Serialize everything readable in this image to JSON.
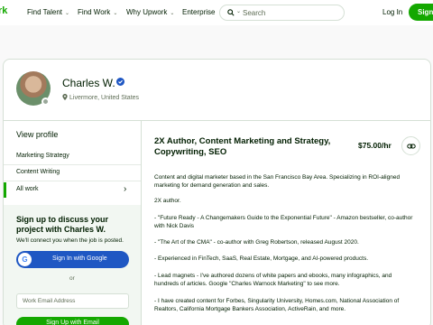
{
  "nav": {
    "logo": "rk",
    "find_talent": "Find Talent",
    "find_work": "Find Work",
    "why_upwork": "Why Upwork",
    "enterprise": "Enterprise",
    "search_placeholder": "Search",
    "login": "Log In",
    "signup": "Sign"
  },
  "profile": {
    "name": "Charles W.",
    "location": "Livermore, United States",
    "headline": "2X Author, Content Marketing and Strategy, Copywriting, SEO",
    "rate": "$75.00/hr",
    "overview": [
      "Content and digital marketer based in the San Francisco Bay Area. Specializing in ROI-aligned marketing for demand generation and sales.",
      "2X author.",
      "- \"Future Ready - A Changemakers Guide to the Exponential Future\" - Amazon bestseller, co-author with Nick Davis",
      "- \"The Art of the CMA\" - co-author with Greg Robertson, released August 2020.",
      "- Experienced in FinTech, SaaS, Real Estate, Mortgage, and AI-powered products.",
      "- Lead magnets - I've authored dozens of white papers and ebooks, many infographics, and hundreds of articles. Google \"Charles Warnock Marketing\" to see more.",
      "- I have created content for Forbes, Singularity University, Homes.com, National Association of Realtors, California Mortgage Bankers Association, ActiveRain, and more."
    ]
  },
  "sidebar": {
    "view_profile": "View profile",
    "items": [
      "Marketing Strategy",
      "Content Writing",
      "All work"
    ]
  },
  "signup_box": {
    "title": "Sign up to discuss your project with Charles W.",
    "subtitle": "We'll connect you when the job is posted.",
    "google_button": "Sign In with Google",
    "or": "or",
    "email_placeholder": "Work Email Address",
    "email_button": "Sign Up with Email"
  },
  "colors": {
    "brand_green": "#14a800",
    "google_blue": "#1f57c3",
    "verified_blue": "#1f57c3"
  }
}
